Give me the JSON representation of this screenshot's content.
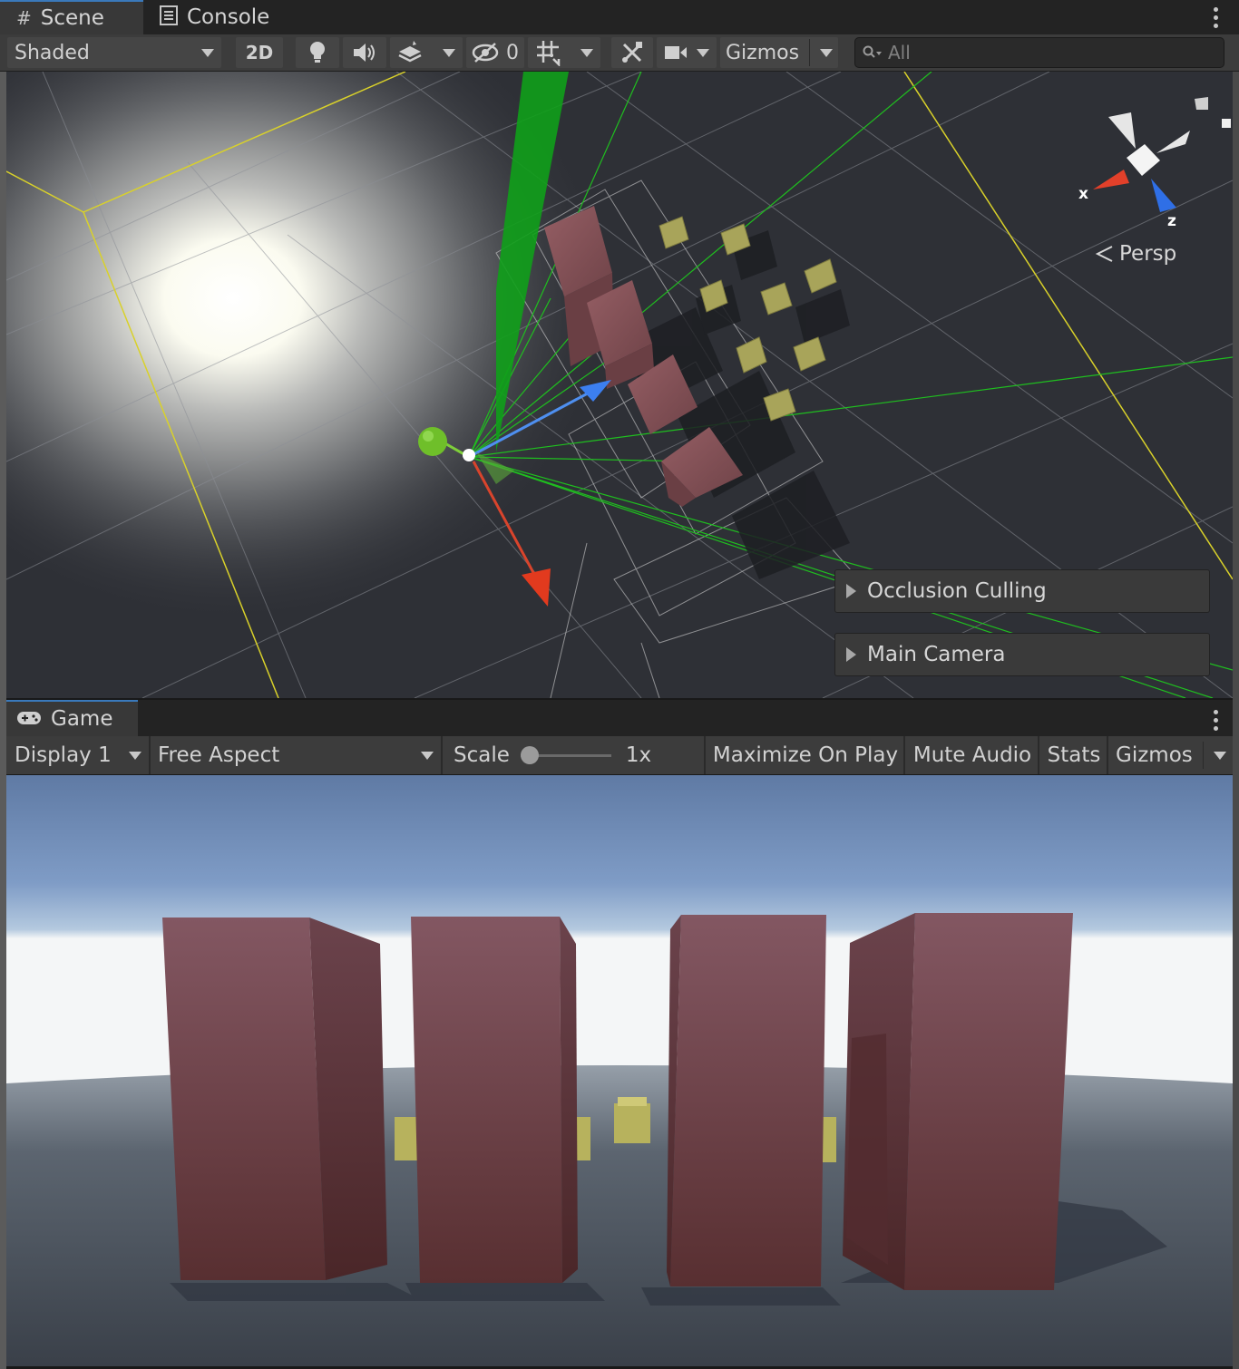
{
  "scene_window": {
    "tabs": [
      {
        "label": "Scene",
        "icon": "hash-icon",
        "active": true
      },
      {
        "label": "Console",
        "icon": "console-icon",
        "active": false
      }
    ],
    "toolbar": {
      "draw_mode": "Shaded",
      "mode_2d": "2D",
      "hidden_count": "0",
      "gizmos": "Gizmos",
      "search_placeholder": "All"
    },
    "orientation_gizmo": {
      "x_label": "x",
      "z_label": "z",
      "projection": "Persp"
    },
    "overlays": [
      {
        "label": "Occlusion Culling"
      },
      {
        "label": "Main Camera"
      }
    ]
  },
  "game_window": {
    "tab": {
      "label": "Game",
      "icon": "gamepad-icon"
    },
    "toolbar": {
      "display": "Display 1",
      "aspect": "Free Aspect",
      "scale_label": "Scale",
      "scale_value": "1x",
      "scale_fraction": 0.0,
      "maximize": "Maximize On Play",
      "mute": "Mute Audio",
      "stats": "Stats",
      "gizmos": "Gizmos"
    }
  },
  "colors": {
    "accent_tab": "#3a79bb",
    "box_red": "#7d4f55",
    "cube_yellow": "#a8a45a",
    "axis_x": "#e2402a",
    "axis_y": "#7fcf3a",
    "axis_z": "#3c7ff0",
    "frustum_green": "#1fbf1f"
  }
}
